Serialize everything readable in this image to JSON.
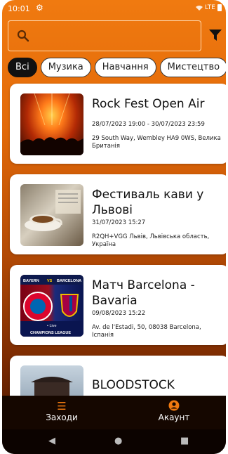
{
  "status": {
    "time": "10:01",
    "network": "LTE"
  },
  "search": {
    "placeholder": ""
  },
  "chips": [
    "Всі",
    "Музика",
    "Навчання",
    "Мистецтво"
  ],
  "events": [
    {
      "title": "Rock Fest Open Air",
      "date": "28/07/2023 19:00 - 30/07/2023 23:59",
      "address": "29 South Way, Wembley HA9 0WS, Велика Британія"
    },
    {
      "title": "Фестиваль кави у Львові",
      "date": "31/07/2023 15:27",
      "address": "R2QH+VGG Львів, Львівська область, Україна"
    },
    {
      "title": "Матч Barcelona - Bavaria",
      "date": "09/08/2023 15:22",
      "address": "Av. de l'Estadi, 50, 08038 Barcelona, Іспанія"
    },
    {
      "title": "BLOODSTOCK",
      "date": "",
      "address": ""
    }
  ],
  "thumb_text": {
    "bayern": "BAYERN",
    "vs": "VS",
    "barcelona": "BARCELONA",
    "live": "• Live",
    "league": "CHAMPIONS LEAGUE"
  },
  "nav": {
    "events_label": "Заходи",
    "account_label": "Акаунт"
  },
  "colors": {
    "accent": "#f07a10",
    "nav_bg": "#150700"
  }
}
